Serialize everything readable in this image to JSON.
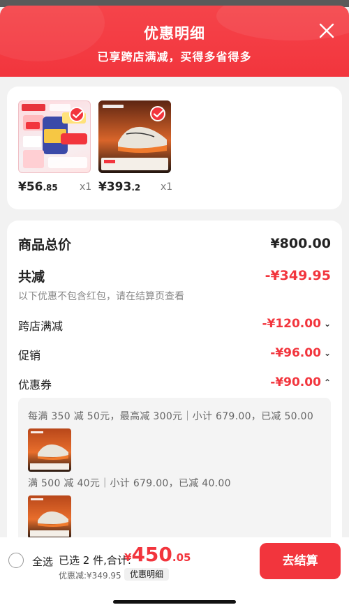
{
  "header": {
    "title": "优惠明细",
    "subtitle": "已享跨店满减，买得多省得多"
  },
  "products": [
    {
      "price_int": "¥56",
      "price_dec": ".85",
      "qty": "x1",
      "image": "supplement-product",
      "checked": true
    },
    {
      "price_int": "¥393",
      "price_dec": ".2",
      "qty": "x1",
      "image": "running-shoe-product",
      "checked": true
    }
  ],
  "detail": {
    "goods_total_label": "商品总价",
    "goods_total_value": "¥800.00",
    "total_reduce_label": "共减",
    "total_reduce_value": "-¥349.95",
    "note": "以下优惠不包含红包，请在结算页查看",
    "rows": [
      {
        "label": "跨店满减",
        "value": "-¥120.00",
        "chevron": "⌄"
      },
      {
        "label": "促销",
        "value": "-¥96.00",
        "chevron": "⌄"
      },
      {
        "label": "优惠券",
        "value": "-¥90.00",
        "chevron": "⌃"
      }
    ],
    "coupons": [
      {
        "rule": "每满 350 减 50元，最高减 300元｜小计 679.00，已减 50.00"
      },
      {
        "rule": "满 500 减 40元｜小计 679.00，已减 40.00"
      }
    ]
  },
  "bottom": {
    "select_all": "全选",
    "selected_prefix": "已选 2 件,合计:",
    "total_currency": "¥",
    "total_int": "450",
    "total_dec": ".05",
    "discount": "优惠减:¥349.95",
    "detail_button": "优惠明细",
    "checkout": "去结算"
  },
  "colors": {
    "accent": "#f2353d"
  }
}
